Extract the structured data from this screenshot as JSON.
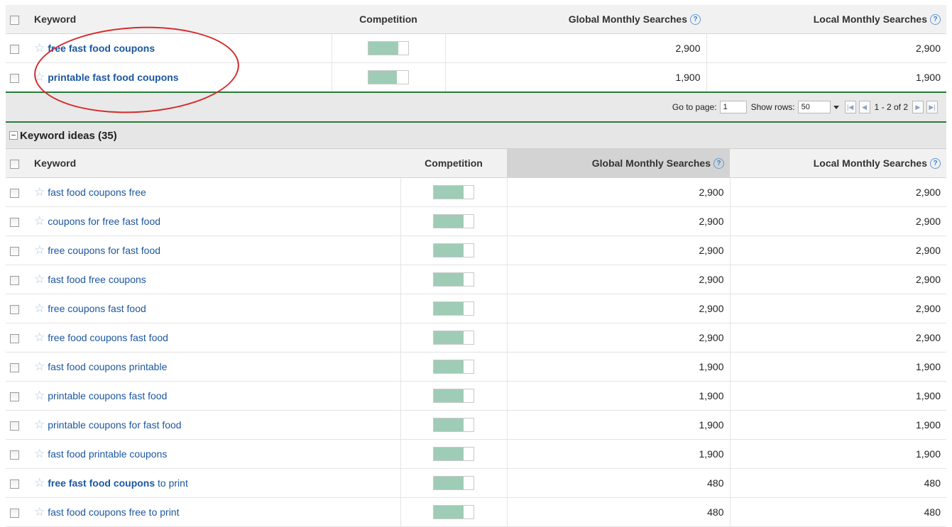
{
  "headers": {
    "keyword": "Keyword",
    "competition": "Competition",
    "global": "Global Monthly Searches",
    "local": "Local Monthly Searches",
    "help_glyph": "?"
  },
  "top_rows": [
    {
      "keyword_bold": "free fast food coupons",
      "keyword_rest": "",
      "competition": 0.75,
      "global": "2,900",
      "local": "2,900"
    },
    {
      "keyword_bold": "printable fast food coupons",
      "keyword_rest": "",
      "competition": 0.72,
      "global": "1,900",
      "local": "1,900"
    }
  ],
  "pager": {
    "goto_label": "Go to page:",
    "goto_value": "1",
    "show_rows_label": "Show rows:",
    "rows_value": "50",
    "range": "1 - 2 of 2"
  },
  "section": {
    "title": "Keyword ideas (35)"
  },
  "ideas": [
    {
      "keyword_bold": "",
      "keyword_rest": "fast food coupons free",
      "competition": 0.75,
      "global": "2,900",
      "local": "2,900"
    },
    {
      "keyword_bold": "",
      "keyword_rest": "coupons for free fast food",
      "competition": 0.75,
      "global": "2,900",
      "local": "2,900"
    },
    {
      "keyword_bold": "",
      "keyword_rest": "free coupons for fast food",
      "competition": 0.75,
      "global": "2,900",
      "local": "2,900"
    },
    {
      "keyword_bold": "",
      "keyword_rest": "fast food free coupons",
      "competition": 0.75,
      "global": "2,900",
      "local": "2,900"
    },
    {
      "keyword_bold": "",
      "keyword_rest": "free coupons fast food",
      "competition": 0.75,
      "global": "2,900",
      "local": "2,900"
    },
    {
      "keyword_bold": "",
      "keyword_rest": "free food coupons fast food",
      "competition": 0.75,
      "global": "2,900",
      "local": "2,900"
    },
    {
      "keyword_bold": "",
      "keyword_rest": "fast food coupons printable",
      "competition": 0.75,
      "global": "1,900",
      "local": "1,900"
    },
    {
      "keyword_bold": "",
      "keyword_rest": "printable coupons fast food",
      "competition": 0.75,
      "global": "1,900",
      "local": "1,900"
    },
    {
      "keyword_bold": "",
      "keyword_rest": "printable coupons for fast food",
      "competition": 0.75,
      "global": "1,900",
      "local": "1,900"
    },
    {
      "keyword_bold": "",
      "keyword_rest": "fast food printable coupons",
      "competition": 0.75,
      "global": "1,900",
      "local": "1,900"
    },
    {
      "keyword_bold": "free fast food coupons",
      "keyword_rest": " to print",
      "competition": 0.75,
      "global": "480",
      "local": "480"
    },
    {
      "keyword_bold": "",
      "keyword_rest": "fast food coupons free to print",
      "competition": 0.75,
      "global": "480",
      "local": "480"
    }
  ],
  "colors": {
    "link": "#1c57a0",
    "competition_fill": "#9fccb7",
    "highlight_oval": "#d42a2a",
    "divider_green": "#2a7a3a"
  },
  "icons": {
    "star": "star-outline-icon",
    "help": "help-circle-icon",
    "collapse": "minus-box-icon"
  }
}
